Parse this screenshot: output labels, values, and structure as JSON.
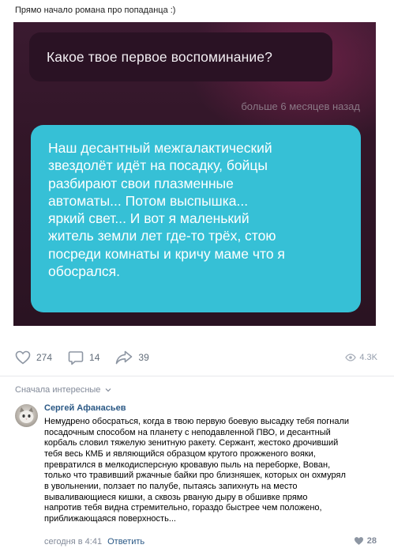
{
  "post": {
    "caption": "Прямо начало романа про попаданца :)",
    "image": {
      "question": "Какое твое первое воспоминание?",
      "time_ago": "больше 6 месяцев назад",
      "answer": "Наш десантный межгалактический\nзвездолёт идёт на посадку, бойцы\nразбирают свои плазменные\nавтоматы... Потом выспышка...\nяркий свет... И вот я маленький\nжитель земли лет где-то трёх, стою\nпосреди комнаты и кричу маме что я\nобосрался."
    },
    "actions": {
      "likes": "274",
      "comments": "14",
      "shares": "39",
      "views": "4.3K"
    }
  },
  "comments_section": {
    "sort_label": "Сначала интересные",
    "comment": {
      "author": "Сергей Афанасьев",
      "text": "Немудрено обосраться, когда в твою первую боевую высадку тебя погнали\nпосадочным способом на планету с неподавленной ПВО, и десантный\nкорбаль словил тяжелую зенитную ракету. Сержант, жестоко дрочивший\nтебя весь КМБ и являющийся образцом крутого прожженого вояки,\nпревратился в мелкодисперсную кровавую пыль на переборке, Вован,\nтолько что травивший ржачные байки про близняшек, которых он охмурял\nв увольнении, ползает по палубе, пытаясь запихнуть на место\nвываливающиеся кишки, а сквозь рваную дыру в обшивке прямо\nнапротив тебя видна стремительно, гораздо быстрее чем положено,\nприближающаяся поверхность...",
      "time": "сегодня в 4:41",
      "reply_label": "Ответить",
      "likes": "28"
    }
  },
  "colors": {
    "answer_bubble": "#36c0d6",
    "question_bubble": "#2a1224",
    "link": "#2a5885"
  },
  "icons": [
    "heart-icon",
    "comment-icon",
    "share-icon",
    "eye-icon",
    "chevron-down-icon",
    "like-heart-icon"
  ]
}
